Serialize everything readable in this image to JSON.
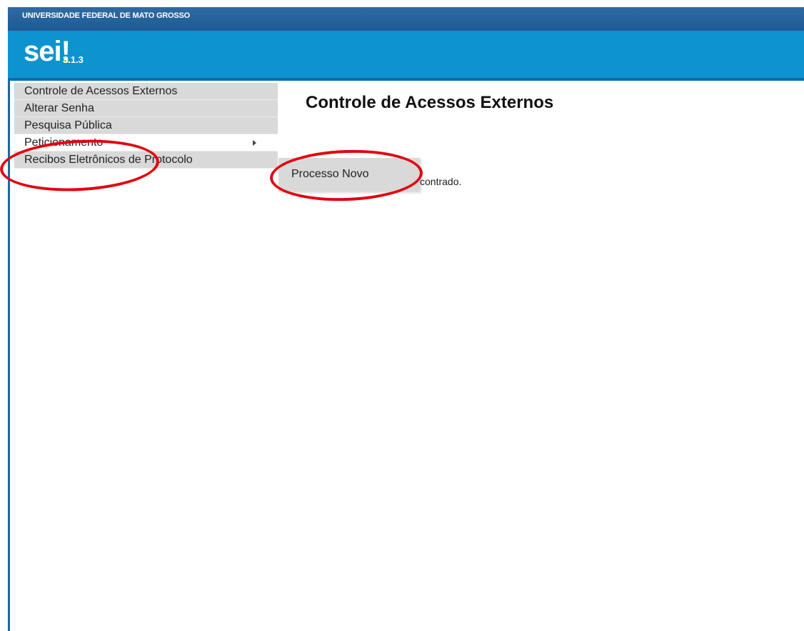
{
  "header": {
    "org_name": "UNIVERSIDADE FEDERAL DE MATO GROSSO",
    "logo": "sei",
    "logo_mark": "!",
    "version": "3.1.3"
  },
  "menu": {
    "items": [
      {
        "label": "Controle de Acessos Externos"
      },
      {
        "label": "Alterar Senha"
      },
      {
        "label": "Pesquisa Pública"
      },
      {
        "label": "Peticionamento",
        "has_submenu": true,
        "active": true
      },
      {
        "label": "Recibos Eletrônicos de Protocolo"
      }
    ]
  },
  "submenu": {
    "items": [
      {
        "label": "Processo Novo"
      }
    ]
  },
  "main": {
    "title": "Controle de Acessos Externos",
    "message_fragment": "contrado."
  },
  "annotations": {
    "highlight_color": "#e3000f"
  },
  "colors": {
    "header_blue": "#1d5a96",
    "logo_bar_blue": "#0c93d0",
    "menu_gray": "#d9d9d9",
    "logo_accent_green": "#8bc34a"
  }
}
